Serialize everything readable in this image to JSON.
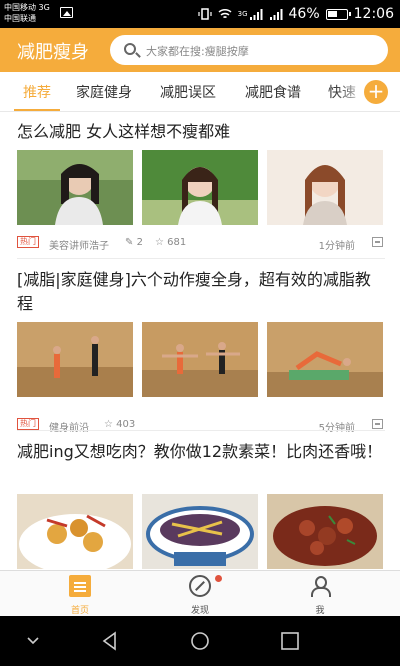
{
  "status_bar": {
    "carrier_1": "中国移动 3G",
    "carrier_2": "中国联通",
    "network": "3G",
    "battery_percent": "46%",
    "time": "12:06"
  },
  "app_bar": {
    "title": "减肥瘦身",
    "search_placeholder": "大家都在搜:瘦腿按摩"
  },
  "tabs": [
    {
      "label": "推荐",
      "active": true
    },
    {
      "label": "家庭健身",
      "active": false
    },
    {
      "label": "减肥误区",
      "active": false
    },
    {
      "label": "减肥食谱",
      "active": false
    },
    {
      "label": "快速",
      "active": false
    }
  ],
  "tab_add_label": "+",
  "articles": [
    {
      "title": "怎么减肥 女人这样想不瘦都难",
      "tag": "热门",
      "source": "美容讲师浩子",
      "comments": "2",
      "stars": "681",
      "time": "1分钟前"
    },
    {
      "title": "[减脂|家庭健身]六个动作瘦全身，超有效的减脂教程",
      "tag": "热门",
      "source": "健身前沿",
      "stars": "403",
      "time": "5分钟前"
    },
    {
      "title": "减肥ing又想吃肉？教你做12款素菜！比肉还香哦！"
    }
  ],
  "bottom_nav": [
    {
      "label": "首页",
      "icon": "home-icon",
      "active": true
    },
    {
      "label": "发现",
      "icon": "compass-icon",
      "active": false
    },
    {
      "label": "我",
      "icon": "user-icon",
      "active": false
    }
  ],
  "colors": {
    "accent": "#f5ac3c",
    "hot_tag": "#e0533e"
  }
}
